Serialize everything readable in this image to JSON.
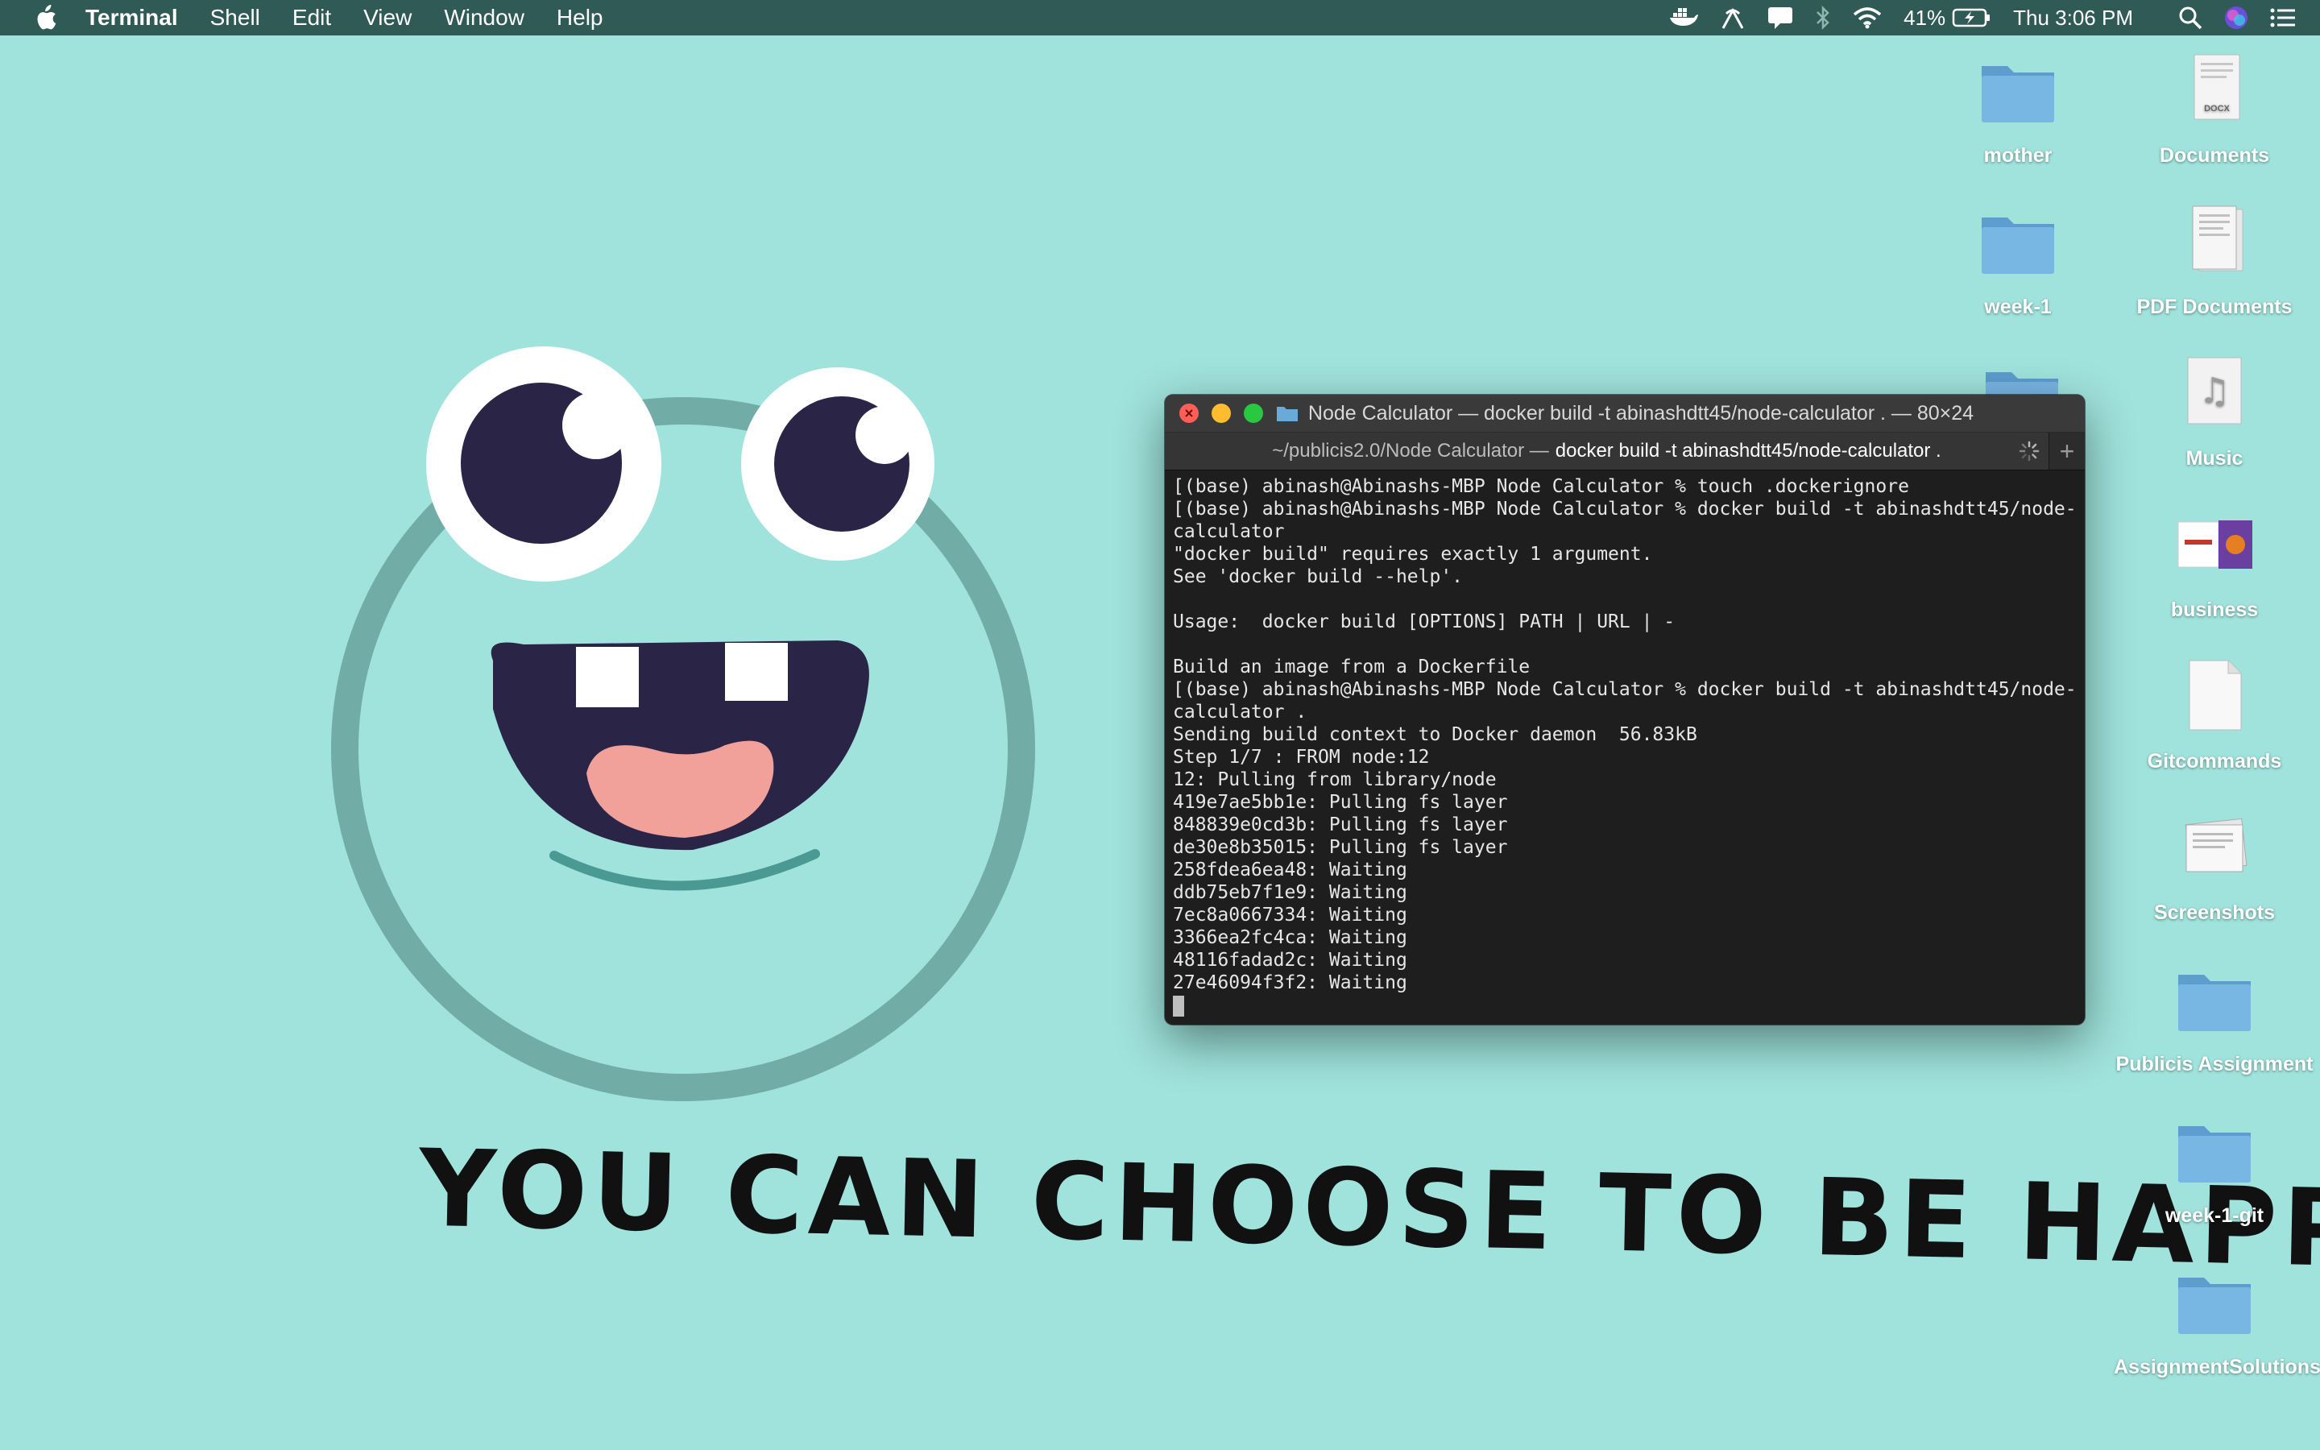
{
  "menubar": {
    "app_name": "Terminal",
    "menus": [
      "Shell",
      "Edit",
      "View",
      "Window",
      "Help"
    ],
    "battery": "41%",
    "clock": "Thu 3:06 PM"
  },
  "wallpaper": {
    "tagline": "YOU CAN CHOOSE TO BE HAPPY"
  },
  "desktop_icons": [
    {
      "label": "mother",
      "type": "folder-icon"
    },
    {
      "label": "Documents",
      "type": "document-icon"
    },
    {
      "label": "week-1",
      "type": "folder-icon"
    },
    {
      "label": "PDF Documents",
      "type": "document-icon"
    },
    {
      "label": "Music",
      "type": "music-icon"
    },
    {
      "label": "business",
      "type": "image-icon"
    },
    {
      "label": "Gitcommands",
      "type": "file-icon"
    },
    {
      "label": "Screenshots",
      "type": "document-icon"
    },
    {
      "label": "Publicis Assignment",
      "type": "folder-icon"
    },
    {
      "label": "week-1-git",
      "type": "folder-icon"
    },
    {
      "label": "AssignmentSolutions",
      "type": "folder-icon"
    }
  ],
  "terminal": {
    "title": "Node Calculator — docker build -t abinashdtt45/node-calculator . — 80×24",
    "tab": {
      "path": "~/publicis2.0/Node Calculator —",
      "command": "docker build -t abinashdtt45/node-calculator ."
    },
    "lines": [
      "[(base) abinash@Abinashs-MBP Node Calculator % touch .dockerignore",
      "[(base) abinash@Abinashs-MBP Node Calculator % docker build -t abinashdtt45/node-",
      "calculator",
      "\"docker build\" requires exactly 1 argument.",
      "See 'docker build --help'.",
      "",
      "Usage:  docker build [OPTIONS] PATH | URL | -",
      "",
      "Build an image from a Dockerfile",
      "[(base) abinash@Abinashs-MBP Node Calculator % docker build -t abinashdtt45/node-",
      "calculator .",
      "Sending build context to Docker daemon  56.83kB",
      "Step 1/7 : FROM node:12",
      "12: Pulling from library/node",
      "419e7ae5bb1e: Pulling fs layer",
      "848839e0cd3b: Pulling fs layer",
      "de30e8b35015: Pulling fs layer",
      "258fdea6ea48: Waiting",
      "ddb75eb7f1e9: Waiting",
      "7ec8a0667334: Waiting",
      "3366ea2fc4ca: Waiting",
      "48116fadad2c: Waiting",
      "27e46094f3f2: Waiting"
    ]
  },
  "colors": {
    "desktop_bg": "#9fe3dc",
    "menubar_bg": "#2f5a56",
    "face_ring": "#72aca6",
    "eye_pupil": "#2a2547",
    "tongue": "#f1a09a",
    "folder_blue": "#6aaad8"
  }
}
